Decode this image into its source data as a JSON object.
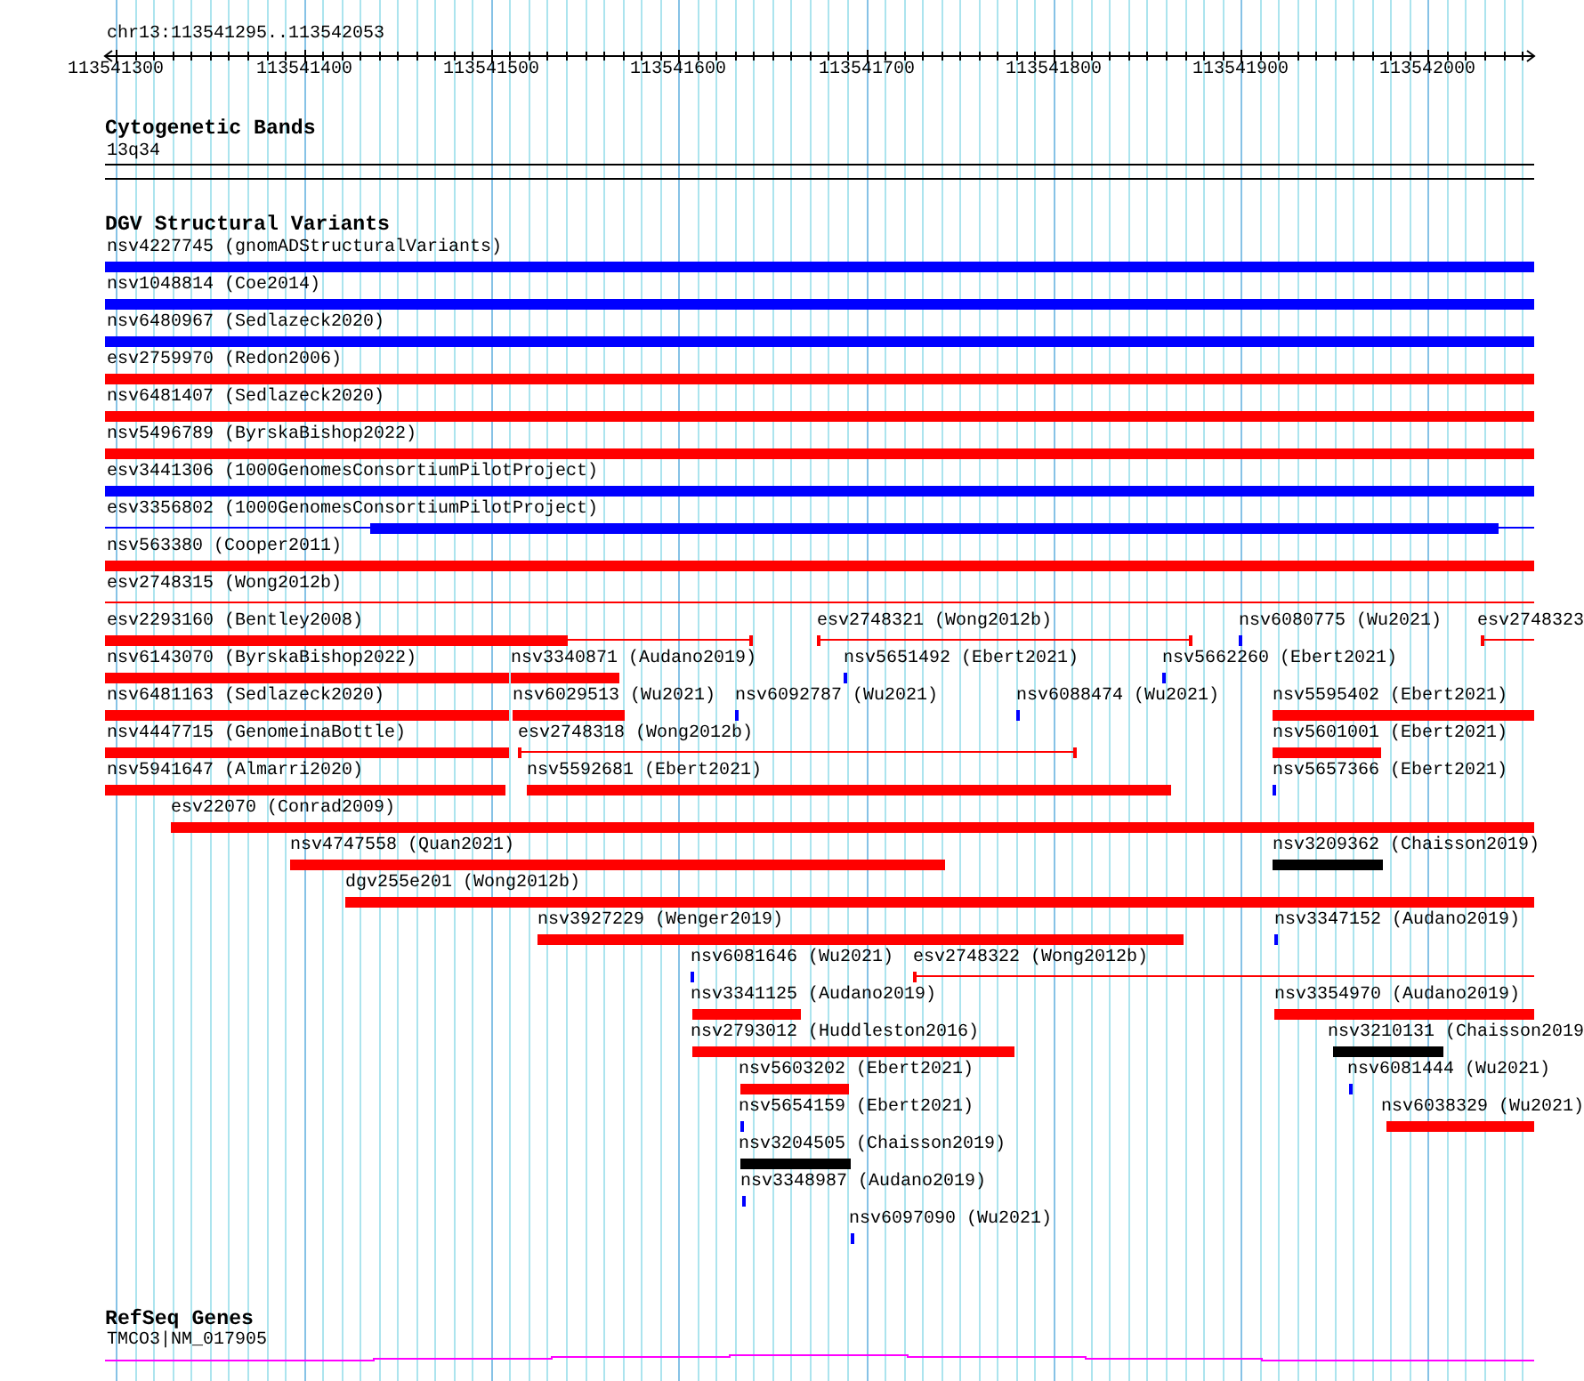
{
  "ruler": {
    "location": "chr13:113541295..113542053",
    "ticks": [
      "113541300",
      "113541400",
      "113541500",
      "113541600",
      "113541700",
      "113541800",
      "113541900",
      "113542000"
    ]
  },
  "tracks": [
    {
      "kind": "cytoband",
      "title": "Cytogenetic Bands",
      "features": [
        {
          "label": "13q34"
        }
      ]
    },
    {
      "kind": "variants",
      "title": "DGV Structural Variants",
      "rows": [
        {
          "features": [
            {
              "label": "nsv4227745 (gnomADStructuralVariants)",
              "kind": "bar",
              "color": "#0000ff"
            }
          ]
        },
        {
          "features": [
            {
              "label": "nsv1048814 (Coe2014)",
              "kind": "bar",
              "color": "#0000ff"
            }
          ]
        },
        {
          "features": [
            {
              "label": "nsv6480967 (Sedlazeck2020)",
              "kind": "bar",
              "color": "#0000ff"
            }
          ]
        },
        {
          "features": [
            {
              "label": "esv2759970 (Redon2006)",
              "kind": "bar",
              "color": "#ff0000"
            }
          ]
        },
        {
          "features": [
            {
              "label": "nsv6481407 (Sedlazeck2020)",
              "kind": "bar",
              "color": "#ff0000"
            }
          ]
        },
        {
          "features": [
            {
              "label": "nsv5496789 (ByrskaBishop2022)",
              "kind": "bar",
              "color": "#ff0000"
            }
          ]
        },
        {
          "features": [
            {
              "label": "esv3441306 (1000GenomesConsortiumPilotProject)",
              "kind": "bar",
              "color": "#0000ff"
            }
          ]
        },
        {
          "features": [
            {
              "label": "esv3356802 (1000GenomesConsortiumPilotProject)",
              "kind": "span",
              "color": "#0000ff"
            }
          ]
        },
        {
          "features": [
            {
              "label": "nsv563380 (Cooper2011)",
              "kind": "bar",
              "color": "#ff0000"
            }
          ]
        },
        {
          "features": [
            {
              "label": "esv2748315 (Wong2012b)",
              "kind": "span",
              "color": "#ff0000"
            }
          ]
        },
        {
          "features": [
            {
              "label": "esv2293160 (Bentley2008)",
              "kind": "span",
              "color": "#ff0000"
            },
            {
              "label": "esv2748321 (Wong2012b)",
              "kind": "span",
              "color": "#ff0000"
            },
            {
              "label": "nsv6080775 (Wu2021)",
              "kind": "tick",
              "color": "#0000ff"
            },
            {
              "label": "esv2748323",
              "kind": "span",
              "color": "#ff0000"
            }
          ]
        },
        {
          "features": [
            {
              "label": "nsv6143070 (ByrskaBishop2022)",
              "kind": "bar",
              "color": "#ff0000"
            },
            {
              "label": "nsv3340871 (Audano2019)",
              "kind": "bar",
              "color": "#ff0000"
            },
            {
              "label": "nsv5651492 (Ebert2021)",
              "kind": "tick",
              "color": "#0000ff"
            },
            {
              "label": "nsv5662260 (Ebert2021)",
              "kind": "tick",
              "color": "#0000ff"
            }
          ]
        },
        {
          "features": [
            {
              "label": "nsv6481163 (Sedlazeck2020)",
              "kind": "bar",
              "color": "#ff0000"
            },
            {
              "label": "nsv6029513 (Wu2021)",
              "kind": "bar",
              "color": "#ff0000"
            },
            {
              "label": "nsv6092787 (Wu2021)",
              "kind": "tick",
              "color": "#0000ff"
            },
            {
              "label": "nsv6088474 (Wu2021)",
              "kind": "tick",
              "color": "#0000ff"
            },
            {
              "label": "nsv5595402 (Ebert2021)",
              "kind": "bar",
              "color": "#ff0000"
            }
          ]
        },
        {
          "features": [
            {
              "label": "nsv4447715 (GenomeinaBottle)",
              "kind": "bar",
              "color": "#ff0000"
            },
            {
              "label": "esv2748318 (Wong2012b)",
              "kind": "span",
              "color": "#ff0000"
            },
            {
              "label": "nsv5601001 (Ebert2021)",
              "kind": "bar",
              "color": "#ff0000"
            }
          ]
        },
        {
          "features": [
            {
              "label": "nsv5941647 (Almarri2020)",
              "kind": "bar",
              "color": "#ff0000"
            },
            {
              "label": "nsv5592681 (Ebert2021)",
              "kind": "bar",
              "color": "#ff0000"
            },
            {
              "label": "nsv5657366 (Ebert2021)",
              "kind": "tick",
              "color": "#0000ff"
            }
          ]
        },
        {
          "features": [
            {
              "label": "esv22070 (Conrad2009)",
              "kind": "bar",
              "color": "#ff0000"
            }
          ]
        },
        {
          "features": [
            {
              "label": "nsv4747558 (Quan2021)",
              "kind": "bar",
              "color": "#ff0000"
            },
            {
              "label": "nsv3209362 (Chaisson2019)",
              "kind": "bar",
              "color": "#000000"
            }
          ]
        },
        {
          "features": [
            {
              "label": "dgv255e201 (Wong2012b)",
              "kind": "bar",
              "color": "#ff0000"
            }
          ]
        },
        {
          "features": [
            {
              "label": "nsv3927229 (Wenger2019)",
              "kind": "bar",
              "color": "#ff0000"
            },
            {
              "label": "nsv3347152 (Audano2019)",
              "kind": "tick",
              "color": "#0000ff"
            }
          ]
        },
        {
          "features": [
            {
              "label": "nsv6081646 (Wu2021)",
              "kind": "tick",
              "color": "#0000ff"
            },
            {
              "label": "esv2748322 (Wong2012b)",
              "kind": "span",
              "color": "#ff0000"
            }
          ]
        },
        {
          "features": [
            {
              "label": "nsv3341125 (Audano2019)",
              "kind": "bar",
              "color": "#ff0000"
            },
            {
              "label": "nsv3354970 (Audano2019)",
              "kind": "bar",
              "color": "#ff0000"
            }
          ]
        },
        {
          "features": [
            {
              "label": "nsv2793012 (Huddleston2016)",
              "kind": "bar",
              "color": "#ff0000"
            },
            {
              "label": "nsv3210131 (Chaisson2019",
              "kind": "bar",
              "color": "#000000"
            }
          ]
        },
        {
          "features": [
            {
              "label": "nsv5603202 (Ebert2021)",
              "kind": "bar",
              "color": "#ff0000"
            },
            {
              "label": "nsv6081444 (Wu2021)",
              "kind": "tick",
              "color": "#0000ff"
            }
          ]
        },
        {
          "features": [
            {
              "label": "nsv5654159 (Ebert2021)",
              "kind": "tick",
              "color": "#0000ff"
            },
            {
              "label": "nsv6038329 (Wu2021)",
              "kind": "bar",
              "color": "#ff0000"
            }
          ]
        },
        {
          "features": [
            {
              "label": "nsv3204505 (Chaisson2019)",
              "kind": "bar",
              "color": "#000000"
            }
          ]
        },
        {
          "features": [
            {
              "label": "nsv3348987 (Audano2019)",
              "kind": "tick",
              "color": "#0000ff"
            }
          ]
        },
        {
          "features": [
            {
              "label": "nsv6097090 (Wu2021)",
              "kind": "tick",
              "color": "#0000ff"
            }
          ]
        }
      ]
    },
    {
      "kind": "genes",
      "title": "RefSeq Genes",
      "features": [
        {
          "label": "TMCO3|NM_017905"
        }
      ]
    }
  ]
}
